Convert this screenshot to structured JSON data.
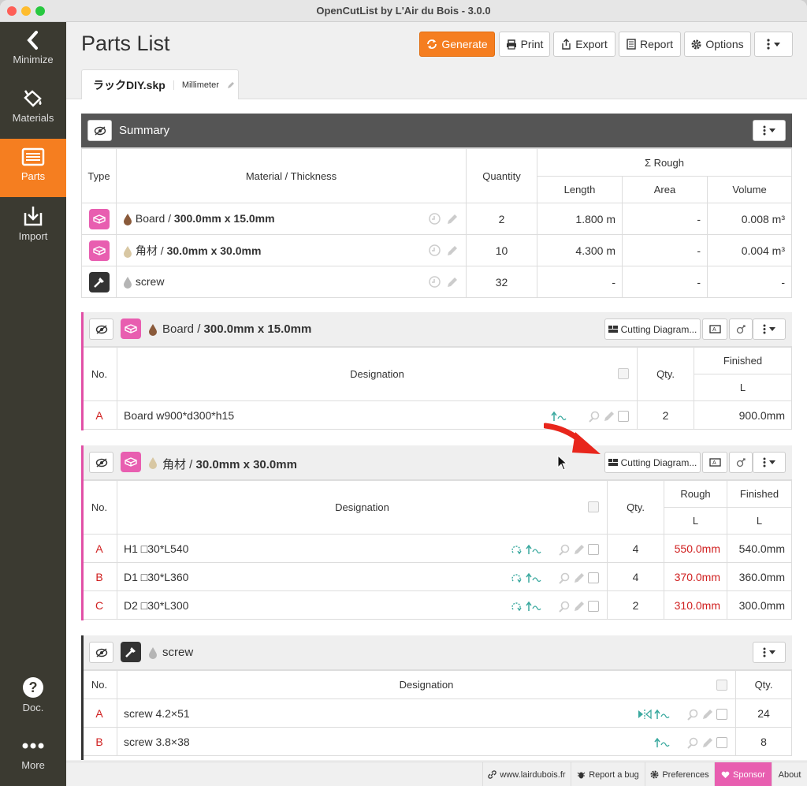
{
  "window": {
    "title": "OpenCutList by L'Air du Bois - 3.0.0"
  },
  "sidebar": {
    "items": [
      {
        "label": "Minimize",
        "icon": "chevron-left-icon"
      },
      {
        "label": "Materials",
        "icon": "paint-bucket-icon"
      },
      {
        "label": "Parts",
        "icon": "list-icon"
      },
      {
        "label": "Import",
        "icon": "import-icon"
      },
      {
        "label": "Doc.",
        "icon": "question-icon"
      },
      {
        "label": "More",
        "icon": "dots-icon"
      }
    ]
  },
  "header": {
    "title": "Parts List",
    "buttons": {
      "generate": "Generate",
      "print": "Print",
      "export": "Export",
      "report": "Report",
      "options": "Options"
    }
  },
  "tab": {
    "filename": "ラックDIY.skp",
    "unit": "Millimeter"
  },
  "summary": {
    "title": "Summary",
    "headers": {
      "type": "Type",
      "material": "Material / Thickness",
      "quantity": "Quantity",
      "rough": "Σ Rough",
      "length": "Length",
      "area": "Area",
      "volume": "Volume"
    },
    "rows": [
      {
        "material": "Board",
        "thickness": "300.0mm x 15.0mm",
        "quantity": "2",
        "length": "1.800 m",
        "area": "-",
        "volume": "0.008 m³",
        "type_color": "#e85eb0",
        "drop_color": "#8a5a3a"
      },
      {
        "material": "角材",
        "thickness": "30.0mm x 30.0mm",
        "quantity": "10",
        "length": "4.300 m",
        "area": "-",
        "volume": "0.004 m³",
        "type_color": "#e85eb0",
        "drop_color": "#d8c7a3"
      },
      {
        "material": "screw",
        "thickness": "",
        "quantity": "32",
        "length": "-",
        "area": "-",
        "volume": "-",
        "type_color": "#333333",
        "drop_color": "#b5b5b5"
      }
    ]
  },
  "group1": {
    "material": "Board",
    "thickness": "300.0mm x 15.0mm",
    "cutting_label": "Cutting Diagram...",
    "headers": {
      "no": "No.",
      "designation": "Designation",
      "qty": "Qty.",
      "finished": "Finished",
      "l": "L"
    },
    "rows": [
      {
        "no": "A",
        "name": "Board w900*d300*h15",
        "qty": "2",
        "finished": "900.0mm"
      }
    ]
  },
  "group2": {
    "material": "角材",
    "thickness": "30.0mm x 30.0mm",
    "cutting_label": "Cutting Diagram...",
    "headers": {
      "no": "No.",
      "designation": "Designation",
      "qty": "Qty.",
      "rough": "Rough",
      "finished": "Finished",
      "l": "L"
    },
    "rows": [
      {
        "no": "A",
        "name": "H1 □30*L540",
        "qty": "4",
        "rough": "550.0mm",
        "finished": "540.0mm"
      },
      {
        "no": "B",
        "name": "D1 □30*L360",
        "qty": "4",
        "rough": "370.0mm",
        "finished": "360.0mm"
      },
      {
        "no": "C",
        "name": "D2 □30*L300",
        "qty": "2",
        "rough": "310.0mm",
        "finished": "300.0mm"
      }
    ]
  },
  "group3": {
    "material": "screw",
    "headers": {
      "no": "No.",
      "designation": "Designation",
      "qty": "Qty."
    },
    "rows": [
      {
        "no": "A",
        "name": "screw 4.2×51",
        "qty": "24"
      },
      {
        "no": "B",
        "name": "screw 3.8×38",
        "qty": "8"
      }
    ]
  },
  "footer": {
    "website": "www.lairdubois.fr",
    "bug": "Report a bug",
    "preferences": "Preferences",
    "sponsor": "Sponsor",
    "about": "About"
  },
  "colors": {
    "accent": "#f57e20",
    "pink": "#e85eb0",
    "sidebar": "#3b3a31",
    "red": "#d02020",
    "teal": "#3aa99f"
  }
}
